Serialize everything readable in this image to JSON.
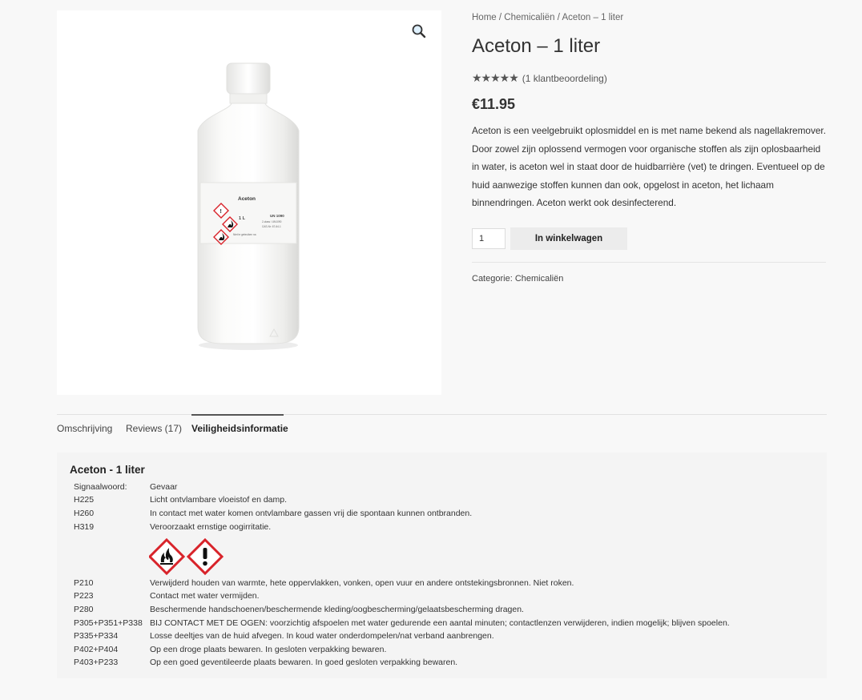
{
  "product": {
    "image_label": {
      "title": "Aceton",
      "volume": "1 L",
      "un": "UN 1090",
      "sub": "2-class / UN1090",
      "cas": "CAS-Nr: 67-64-1",
      "note": "Niet te gebruiken na"
    },
    "zoom_icon": "magnifier-icon"
  },
  "breadcrumb": {
    "home": "Home",
    "sep1": " / ",
    "category": "Chemicaliën",
    "sep2": " / ",
    "current": "Aceton – 1 liter"
  },
  "title": "Aceton – 1 liter",
  "rating": {
    "stars": "★★★★★",
    "value": 5,
    "max": 5,
    "review_link": "(1 klantbeoordeling)"
  },
  "price": "€11.95",
  "description": "Aceton is een veelgebruikt oplosmiddel en is met name bekend als nagellakremover. Door zowel zijn oplossend vermogen voor organische stoffen als zijn oplosbaarheid in water, is aceton wel in staat door de huidbarrière (vet) te dringen. Eventueel op de huid aanwezige stoffen kunnen dan ook, opgelost in aceton, het lichaam binnendringen. Aceton werkt ook desinfecterend.",
  "cart": {
    "quantity": "1",
    "button": "In winkelwagen"
  },
  "meta": {
    "label": "Categorie: ",
    "category": "Chemicaliën"
  },
  "tabs": [
    {
      "label": "Omschrijving",
      "active": false
    },
    {
      "label": "Reviews (17)",
      "active": false
    },
    {
      "label": "Veiligheidsinformatie",
      "active": true
    }
  ],
  "safety": {
    "title": "Aceton - 1 liter",
    "hazard_rows": [
      {
        "code": "Signaalwoord:",
        "text": "Gevaar"
      },
      {
        "code": "H225",
        "text": "Licht ontvlambare vloeistof en damp."
      },
      {
        "code": "H260",
        "text": "In contact met water komen ontvlambare gassen vrij die spontaan kunnen ontbranden."
      },
      {
        "code": "H319",
        "text": "Veroorzaakt ernstige oogirritatie."
      }
    ],
    "pictograms": [
      "flame-pictogram-icon",
      "exclamation-pictogram-icon"
    ],
    "precaution_rows": [
      {
        "code": "P210",
        "text": "Verwijderd houden van warmte, hete oppervlakken, vonken, open vuur en andere ontstekingsbronnen. Niet roken."
      },
      {
        "code": "P223",
        "text": "Contact met water vermijden."
      },
      {
        "code": "P280",
        "text": "Beschermende handschoenen/beschermende kleding/oogbescherming/gelaatsbescherming dragen."
      },
      {
        "code": "P305+P351+P338",
        "text": "BIJ CONTACT MET DE OGEN: voorzichtig afspoelen met water gedurende een aantal minuten; contactlenzen verwijderen, indien mogelijk; blijven spoelen."
      },
      {
        "code": "P335+P334",
        "text": "Losse deeltjes van de huid afvegen. In koud water onderdompelen/nat verband aanbrengen."
      },
      {
        "code": "P402+P404",
        "text": "Op een droge plaats bewaren. In gesloten verpakking bewaren."
      },
      {
        "code": "P403+P233",
        "text": "Op een goed geventileerde plaats bewaren. In goed gesloten verpakking bewaren."
      }
    ]
  },
  "colors": {
    "background": "#f8f8f8",
    "hazard_red": "#d8232a",
    "button_bg": "#ececec"
  }
}
